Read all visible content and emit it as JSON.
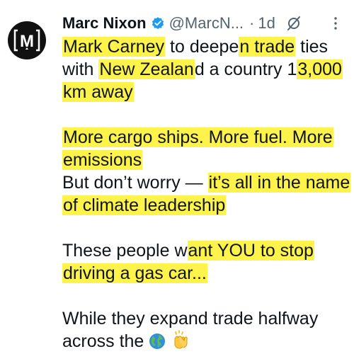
{
  "author": {
    "name": "Marc Nixon",
    "handle": "@MarcN...",
    "separator": "·",
    "time": "1d",
    "avatar_letter": "M"
  },
  "icons": {
    "verified": "verified-badge-icon",
    "grok": "grok-icon",
    "more": "more-options-icon",
    "globe": "globe-emoji",
    "clap": "clapping-hands-emoji"
  },
  "colors": {
    "highlight": "#fdf34a",
    "verified": "#1d9bf0",
    "muted": "#536471"
  },
  "body": {
    "l1": {
      "a": "Mark Carney",
      "b": " to deepe",
      "c": "n trade",
      "d": " ties"
    },
    "l2": {
      "a": "with ",
      "b": "New Zealan",
      "c": "d a country 1",
      "d": "3,000"
    },
    "l3": {
      "a": "km away"
    },
    "l4": {
      "a": "More cargo ships. More fuel. More"
    },
    "l5": {
      "a": "emissions"
    },
    "l6": {
      "a": "But don’t worry — ",
      "b": "it’s all in the name"
    },
    "l7": {
      "a": "of climate leadership"
    },
    "l8": {
      "a": "These people w",
      "b": "ant YOU to stop"
    },
    "l9": {
      "a": "driving a gas car..."
    },
    "l10": {
      "a": "While they expand trade halfway"
    },
    "l11": {
      "a": "across the"
    }
  }
}
